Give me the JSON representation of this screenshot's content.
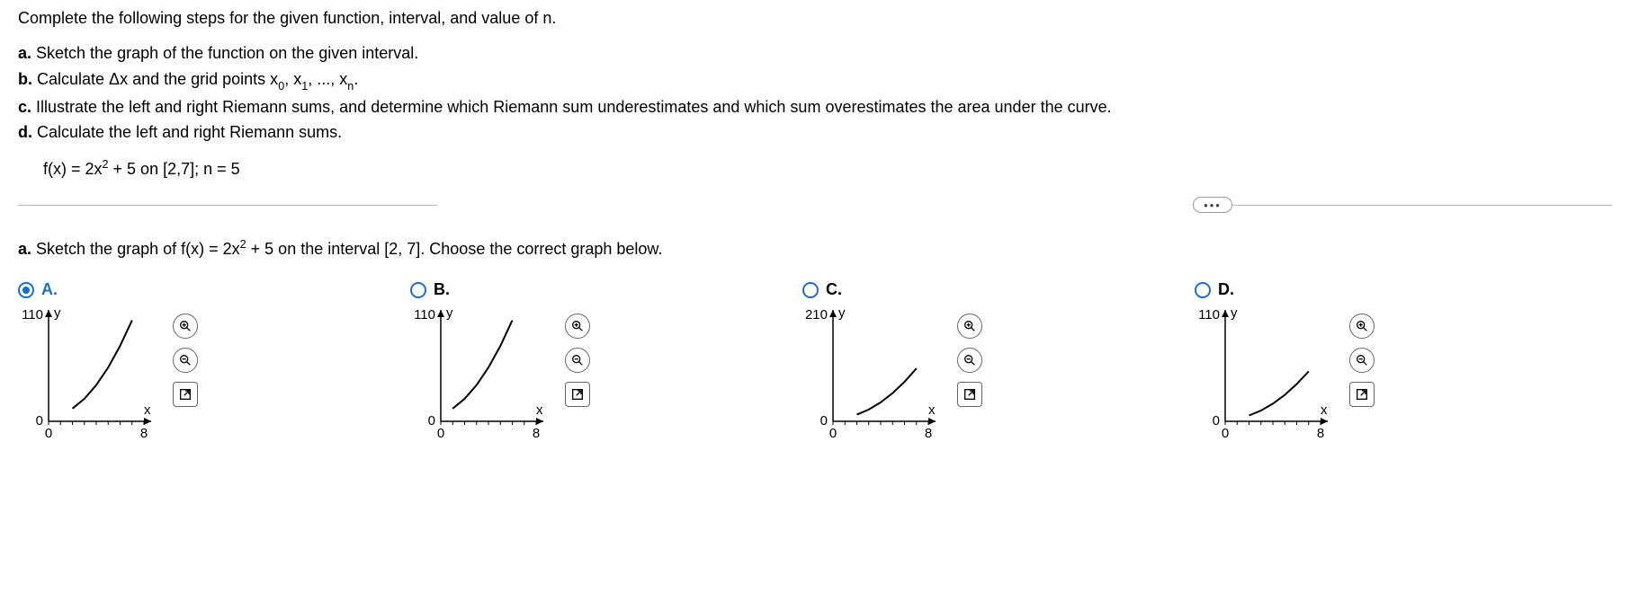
{
  "intro": "Complete the following steps for the given function, interval, and value of n.",
  "steps": {
    "a_bold": "a.",
    "a_text": " Sketch the graph of the function on the given interval.",
    "b_bold": "b.",
    "b_text_1": " Calculate Δx and the grid points x",
    "b_text_2": ", x",
    "b_text_3": ", ..., x",
    "b_text_4": ".",
    "sub0": "0",
    "sub1": "1",
    "subn": "n",
    "c_bold": "c.",
    "c_text": " Illustrate the left and right Riemann sums, and determine which Riemann sum underestimates and which sum overestimates the area under the curve.",
    "d_bold": "d.",
    "d_text": " Calculate the left and right Riemann sums."
  },
  "func": {
    "pre": "f(x) = 2x",
    "sup": "2",
    "post": " + 5 on [2,7]; n = 5"
  },
  "ellipsis": "•••",
  "question_a": {
    "bold": "a.",
    "t1": " Sketch the graph of f(x) = 2x",
    "sup": "2",
    "t2": " + 5 on the interval [2, 7]. Choose the correct graph below."
  },
  "options": [
    {
      "label": "A.",
      "selected": true,
      "ymax": "110",
      "ymin": "0",
      "xmin": "0",
      "xmax": "8",
      "ylabel": "y",
      "xlabel": "x",
      "curve": "A"
    },
    {
      "label": "B.",
      "selected": false,
      "ymax": "110",
      "ymin": "0",
      "xmin": "0",
      "xmax": "8",
      "ylabel": "y",
      "xlabel": "x",
      "curve": "B"
    },
    {
      "label": "C.",
      "selected": false,
      "ymax": "210",
      "ymin": "0",
      "xmin": "0",
      "xmax": "8",
      "ylabel": "y",
      "xlabel": "x",
      "curve": "C"
    },
    {
      "label": "D.",
      "selected": false,
      "ymax": "110",
      "ymin": "0",
      "xmin": "0",
      "xmax": "8",
      "ylabel": "y",
      "xlabel": "x",
      "curve": "D"
    }
  ],
  "chart_data": [
    {
      "type": "line",
      "title": "",
      "xlabel": "x",
      "ylabel": "y",
      "xlim": [
        0,
        8
      ],
      "ylim": [
        0,
        110
      ],
      "series": [
        {
          "name": "f",
          "x": [
            2,
            3,
            4,
            5,
            6,
            7
          ],
          "y": [
            13,
            23,
            37,
            55,
            77,
            103
          ]
        }
      ]
    },
    {
      "type": "line",
      "title": "",
      "xlabel": "x",
      "ylabel": "y",
      "xlim": [
        0,
        8
      ],
      "ylim": [
        0,
        110
      ],
      "series": [
        {
          "name": "f",
          "x": [
            1,
            2,
            3,
            4,
            5,
            6
          ],
          "y": [
            13,
            23,
            37,
            55,
            77,
            103
          ]
        }
      ]
    },
    {
      "type": "line",
      "title": "",
      "xlabel": "x",
      "ylabel": "y",
      "xlim": [
        0,
        8
      ],
      "ylim": [
        0,
        210
      ],
      "series": [
        {
          "name": "f",
          "x": [
            2,
            3,
            4,
            5,
            6,
            7
          ],
          "y": [
            13,
            23,
            37,
            55,
            77,
            103
          ]
        }
      ]
    },
    {
      "type": "line",
      "title": "",
      "xlabel": "x",
      "ylabel": "y",
      "xlim": [
        0,
        8
      ],
      "ylim": [
        0,
        110
      ],
      "series": [
        {
          "name": "f",
          "x": [
            2,
            3,
            4,
            5,
            6,
            7
          ],
          "y": [
            6,
            11,
            18,
            27,
            38,
            51
          ]
        }
      ]
    }
  ]
}
